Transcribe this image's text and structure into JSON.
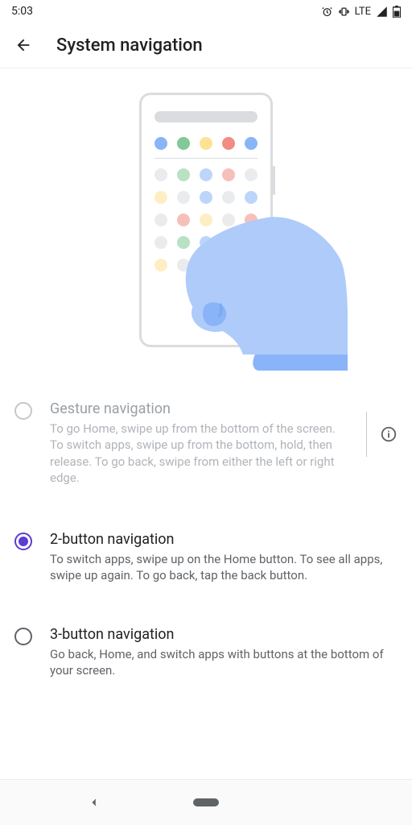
{
  "status": {
    "time": "5:03",
    "network": "LTE"
  },
  "header": {
    "title": "System navigation"
  },
  "options": [
    {
      "title": "Gesture navigation",
      "desc": "To go Home, swipe up from the bottom of the screen. To switch apps, swipe up from the bottom, hold, then release. To go back, swipe from either the left or right edge.",
      "selected": false,
      "disabled": true,
      "info": true
    },
    {
      "title": "2-button navigation",
      "desc": "To switch apps, swipe up on the Home button. To see all apps, swipe up again. To go back, tap the back button.",
      "selected": true,
      "disabled": false,
      "info": false
    },
    {
      "title": "3-button navigation",
      "desc": "Go back, Home, and switch apps with buttons at the bottom of your screen.",
      "selected": false,
      "disabled": false,
      "info": false
    }
  ]
}
